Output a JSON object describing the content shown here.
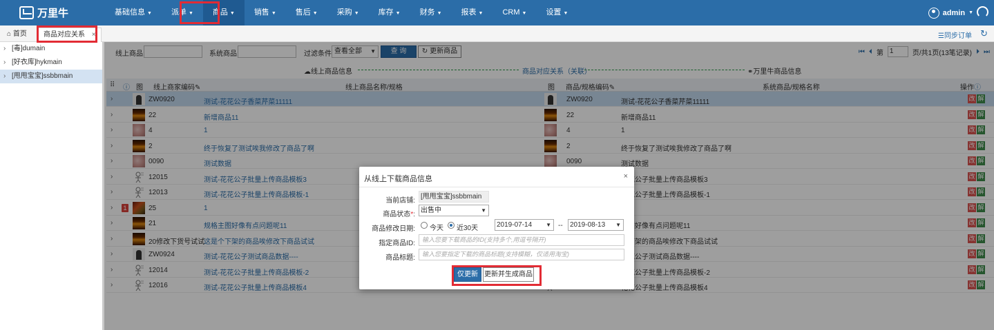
{
  "app": {
    "logo_text": "万里牛"
  },
  "nav": {
    "items": [
      {
        "label": "基础信息"
      },
      {
        "label": "派单"
      },
      {
        "label": "商品"
      },
      {
        "label": "销售"
      },
      {
        "label": "售后"
      },
      {
        "label": "采购"
      },
      {
        "label": "库存"
      },
      {
        "label": "财务"
      },
      {
        "label": "报表"
      },
      {
        "label": "CRM"
      },
      {
        "label": "设置"
      }
    ],
    "active_index": 2,
    "user": "admin"
  },
  "tabs": {
    "home": "首页",
    "current": "商品对应关系",
    "close_symbol": "×",
    "sync_orders": "☰同步订单"
  },
  "sidebar": {
    "items": [
      {
        "label": "[毒]dumain"
      },
      {
        "label": "[好衣库]hykmain"
      },
      {
        "label": "[甩甩宝宝]ssbbmain"
      }
    ]
  },
  "filter": {
    "online_goods_label": "线上商品:",
    "system_goods_label": "系统商品:",
    "filter_condition_label": "过滤条件:",
    "filter_value": "查看全部",
    "query_button": "查 询",
    "update_button": "更新商品"
  },
  "pager": {
    "first": "⏮",
    "prev": "⏴",
    "page_prefix": "第",
    "page_value": "1",
    "page_suffix": "页/共1页(13笔记录)",
    "next": "⏵",
    "last": "⏭"
  },
  "relation": {
    "left": "线上商品信息",
    "mid": "商品对应关系（关联）",
    "right": "万里牛商品信息"
  },
  "grid": {
    "headers": {
      "img": "图",
      "online_code": "线上商家编码",
      "online_name": "线上商品名称/规格",
      "img2": "图",
      "sys_code": "商品/规格编码",
      "sys_name": "系统商品/规格名称",
      "ops": "操作"
    },
    "edit_label": "改",
    "unbind_label": "解",
    "rows": [
      {
        "code": "ZW0920",
        "name": "测试-花花公子香菜芹菜11111",
        "sys_code": "ZW0920",
        "sys_name": "测试-花花公子香菜芹菜11111",
        "thumb": "dark"
      },
      {
        "code": "22",
        "name": "新增商品11",
        "sys_code": "22",
        "sys_name": "新增商品11",
        "thumb": "fire"
      },
      {
        "code": "4",
        "name": "1",
        "sys_code": "4",
        "sys_name": "1",
        "thumb": "pink"
      },
      {
        "code": "2",
        "name": "终于恢复了测试唉我修改了商品了啊",
        "sys_code": "2",
        "sys_name": "终于恢复了测试唉我修改了商品了啊",
        "thumb": "fire"
      },
      {
        "code": "0090",
        "name": "测试数据",
        "sys_code": "0090",
        "sys_name": "测试数据",
        "thumb": "pink"
      },
      {
        "code": "12015",
        "name": "测试-花花公子批量上传商品模板3",
        "sys_code": "",
        "sys_name": "花花公子批量上传商品模板3",
        "thumb": "fig"
      },
      {
        "code": "12013",
        "name": "测试-花花公子批量上传商品模板-1",
        "sys_code": "",
        "sys_name": "花花公子批量上传商品模板-1",
        "thumb": "fig"
      },
      {
        "code": "25",
        "name": "1",
        "sys_code": "",
        "sys_name": "",
        "thumb": "card",
        "badge": "1"
      },
      {
        "code": "21",
        "name": "规格主图好像有点问题呢11",
        "sys_code": "",
        "sys_name": "主图好像有点问题呢11",
        "thumb": "fire"
      },
      {
        "code": "20修改下货号试试",
        "name": "这是个下架的商品唉修改下商品试试",
        "sys_code": "",
        "sys_name": "个下架的商品唉修改下商品试试",
        "thumb": "fire"
      },
      {
        "code": "ZW0924",
        "name": "测试-花花公子测试商品数据----",
        "sys_code": "",
        "sys_name": "花花公子测试商品数据----",
        "thumb": "dark"
      },
      {
        "code": "12014",
        "name": "测试-花花公子批量上传商品模板-2",
        "sys_code": "",
        "sys_name": "花花公子批量上传商品模板-2",
        "thumb": "fig"
      },
      {
        "code": "12016",
        "name": "测试-花花公子批量上传商品模板4",
        "sys_code": "",
        "sys_name": "花花公子批量上传商品模板4",
        "thumb": "fig"
      }
    ]
  },
  "modal": {
    "title": "从线上下载商品信息",
    "close_symbol": "×",
    "store_label": "当前店铺:",
    "store_value": "[甩甩宝宝]ssbbmain",
    "status_label": "商品状态",
    "status_value": "出售中",
    "date_label": "商品修改日期:",
    "today_label": "今天",
    "last30_label": "近30天",
    "date_from": "2019-07-14",
    "date_sep": "--",
    "date_to": "2019-08-13",
    "id_label": "指定商品ID:",
    "id_placeholder": "输入您要下载商品的ID(支持多个,用逗号隔开)",
    "title_label": "商品标题:",
    "title_placeholder": "输入您要指定下载的商品标题(支持模糊，仅适用淘宝)",
    "btn_update_only": "仅更新",
    "btn_update_generate": "更新并生成商品"
  },
  "colors": {
    "nav_bg": "#2b6da8",
    "highlight_red": "#e22b34",
    "edit_red": "#d9534f",
    "unbind_green": "#3c8a4a"
  }
}
